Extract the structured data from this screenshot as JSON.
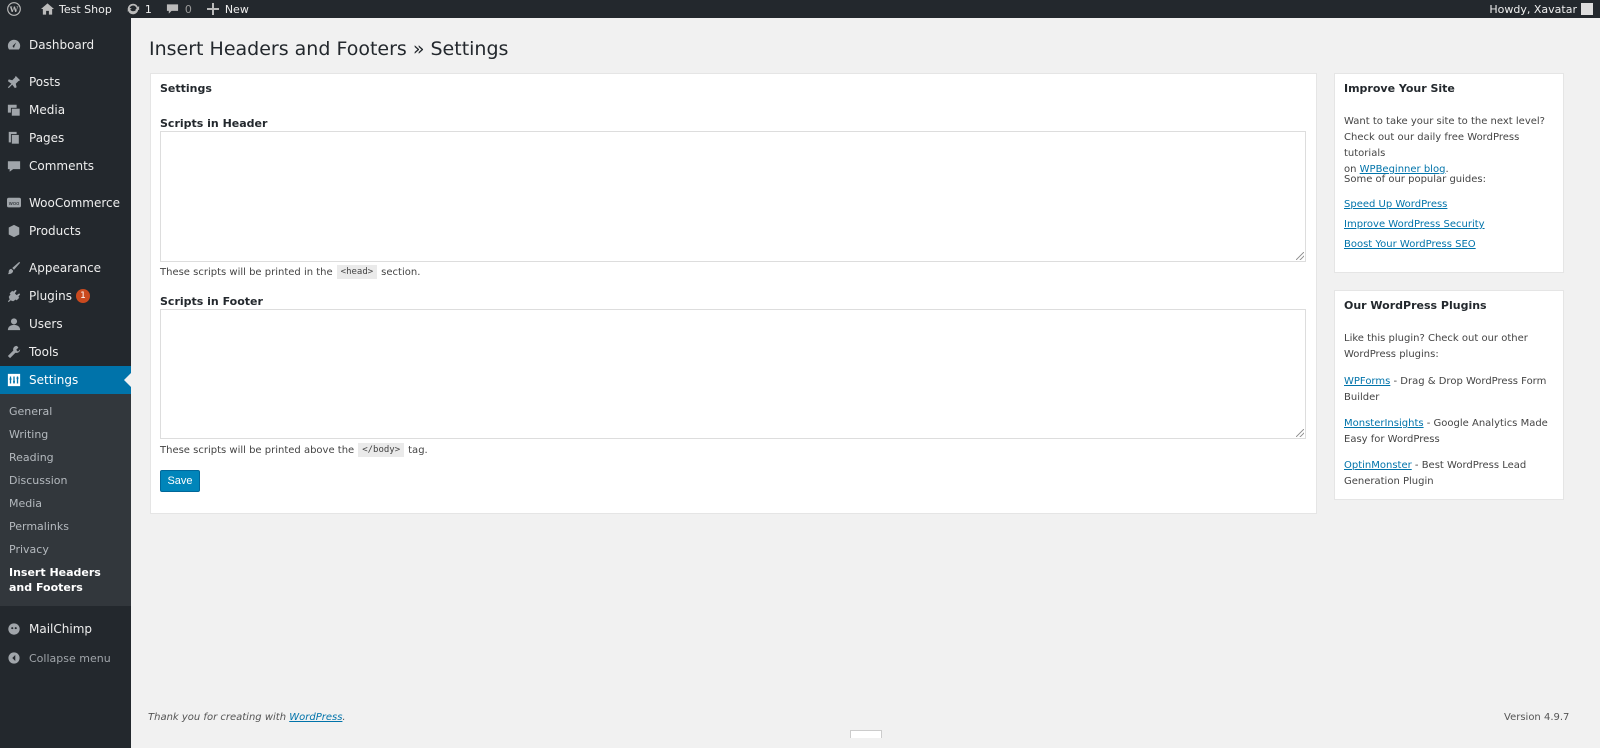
{
  "adminbar": {
    "site_name": "Test Shop",
    "updates_count": "1",
    "comments_count": "0",
    "new_label": "New",
    "howdy": "Howdy, Xavatar"
  },
  "sidebar": {
    "items": [
      {
        "label": "Dashboard",
        "icon": "dashboard-icon"
      },
      {
        "label": "Posts",
        "icon": "pin-icon"
      },
      {
        "label": "Media",
        "icon": "media-icon"
      },
      {
        "label": "Pages",
        "icon": "pages-icon"
      },
      {
        "label": "Comments",
        "icon": "comment-icon"
      },
      {
        "label": "WooCommerce",
        "icon": "woocommerce-icon"
      },
      {
        "label": "Products",
        "icon": "products-icon"
      },
      {
        "label": "Appearance",
        "icon": "brush-icon"
      },
      {
        "label": "Plugins",
        "icon": "plugin-icon",
        "badge": "1"
      },
      {
        "label": "Users",
        "icon": "users-icon"
      },
      {
        "label": "Tools",
        "icon": "wrench-icon"
      },
      {
        "label": "Settings",
        "icon": "settings-icon"
      }
    ],
    "submenu": [
      "General",
      "Writing",
      "Reading",
      "Discussion",
      "Media",
      "Permalinks",
      "Privacy",
      "Insert Headers and Footers"
    ],
    "mailchimp": "MailChimp",
    "collapse": "Collapse menu"
  },
  "main": {
    "title": "Insert Headers and Footers » Settings",
    "settings_panel_title": "Settings",
    "header_label": "Scripts in Header",
    "header_desc_before": "These scripts will be printed in the",
    "header_desc_code": "<head>",
    "header_desc_after": "section.",
    "footer_label": "Scripts in Footer",
    "footer_desc_before": "These scripts will be printed above the",
    "footer_desc_code": "</body>",
    "footer_desc_after": "tag.",
    "save_label": "Save"
  },
  "improve": {
    "title": "Improve Your Site",
    "line1": "Want to take your site to the next level?",
    "line2": "Check out our daily free WordPress tutorials",
    "line3_prefix": "on",
    "blog_link": "WPBeginner blog",
    "line3_suffix": ".",
    "popular": "Some of our popular guides:",
    "links": [
      "Speed Up WordPress",
      "Improve WordPress Security",
      "Boost Your WordPress SEO"
    ]
  },
  "plugins_box": {
    "title": "Our WordPress Plugins",
    "intro1": "Like this plugin? Check out our other",
    "intro2": "WordPress plugins:",
    "p1_link": "WPForms",
    "p1_desc1": " - Drag & Drop WordPress Form",
    "p1_desc2": "Builder",
    "p2_link": "MonsterInsights",
    "p2_desc1": " - Google Analytics Made",
    "p2_desc2": "Easy for WordPress",
    "p3_link": "OptinMonster",
    "p3_desc1": " - Best WordPress Lead",
    "p3_desc2": "Generation Plugin"
  },
  "footer": {
    "thanks_prefix": "Thank you for creating with",
    "thanks_link": "WordPress",
    "thanks_suffix": ".",
    "version": "Version 4.9.7"
  },
  "colors": {
    "adminbar": "#23282d",
    "sidebar": "#23282d",
    "accent": "#0073aa",
    "button": "#0085ba"
  }
}
